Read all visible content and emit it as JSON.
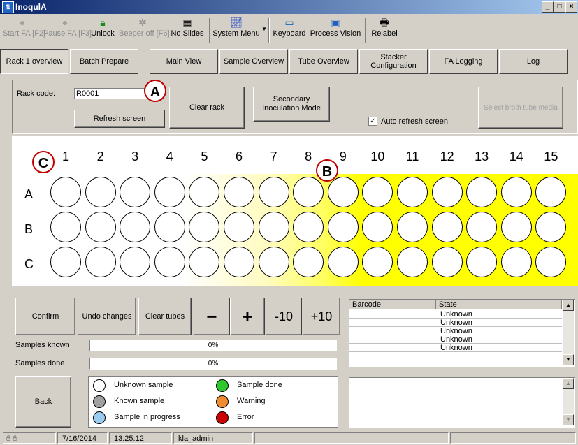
{
  "window": {
    "title": "InoqulA",
    "minimize": "_",
    "maximize": "□",
    "close": "×"
  },
  "toolbar": {
    "start_fa": "Start FA [F2]",
    "pause_fa": "Pause FA [F3]",
    "unlock": "Unlock",
    "beeper_off": "Beeper off [F6]",
    "no_slides": "No Slides",
    "system_menu": "System Menu",
    "keyboard": "Keyboard",
    "process_vision": "Process Vision",
    "relabel": "Relabel"
  },
  "tabs": [
    {
      "label": "Rack 1 overview"
    },
    {
      "label": "Batch Prepare"
    },
    {
      "label": "Main View"
    },
    {
      "label": "Sample Overview"
    },
    {
      "label": "Tube Overview"
    },
    {
      "label": "Stacker Configuration"
    },
    {
      "label": "FA Logging"
    },
    {
      "label": "Log"
    }
  ],
  "rack": {
    "code_label": "Rack code:",
    "code_value": "R0001",
    "refresh_screen": "Refresh screen",
    "clear_rack": "Clear rack",
    "secondary_mode": "Secondary Inoculation Mode",
    "auto_refresh": "Auto refresh screen",
    "auto_refresh_checked": true,
    "select_broth": "Select broth tube media",
    "columns": [
      "1",
      "2",
      "3",
      "4",
      "5",
      "6",
      "7",
      "8",
      "9",
      "10",
      "11",
      "12",
      "13",
      "14",
      "15"
    ],
    "rows": [
      "A",
      "B",
      "C"
    ],
    "well_color": "#ffffff",
    "highlight_color": "#ffff00"
  },
  "callouts": {
    "a": "A",
    "b": "B",
    "c": "C"
  },
  "controls": {
    "confirm": "Confirm",
    "undo_changes": "Undo changes",
    "clear_tubes": "Clear tubes",
    "minus": "−",
    "plus": "+",
    "minus10": "-10",
    "plus10": "+10",
    "back": "Back"
  },
  "progress": {
    "samples_known_label": "Samples known",
    "samples_known_value": "0%",
    "samples_done_label": "Samples done",
    "samples_done_value": "0%"
  },
  "legend": [
    {
      "label": "Unknown sample",
      "color": "#ffffff"
    },
    {
      "label": "Known sample",
      "color": "#a0a0a0"
    },
    {
      "label": "Sample in progress",
      "color": "#99ccf0"
    },
    {
      "label": "Sample done",
      "color": "#2ec82e"
    },
    {
      "label": "Warning",
      "color": "#f08c30"
    },
    {
      "label": "Error",
      "color": "#cc0000"
    }
  ],
  "tube_grid": {
    "headers": [
      "Barcode",
      "State"
    ],
    "rows": [
      {
        "barcode": "",
        "state": "Unknown"
      },
      {
        "barcode": "",
        "state": "Unknown"
      },
      {
        "barcode": "",
        "state": "Unknown"
      },
      {
        "barcode": "",
        "state": "Unknown"
      },
      {
        "barcode": "",
        "state": "Unknown"
      }
    ]
  },
  "status": {
    "date": "7/16/2014",
    "time": "13:25:12",
    "user": "kla_admin"
  }
}
